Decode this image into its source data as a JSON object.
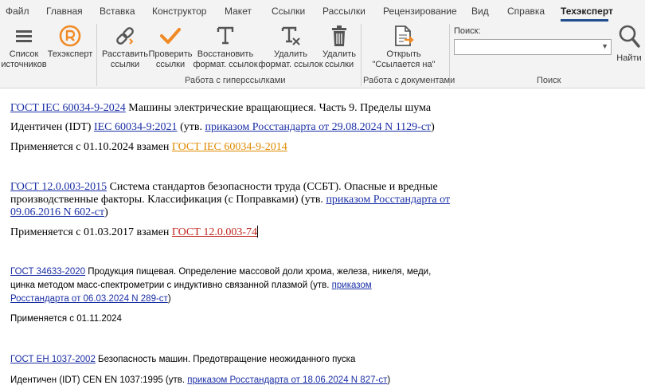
{
  "menu": {
    "tabs": [
      "Файл",
      "Главная",
      "Вставка",
      "Конструктор",
      "Макет",
      "Ссылки",
      "Рассылки",
      "Рецензирование",
      "Вид",
      "Справка",
      "Техэксперт"
    ],
    "active": "Техэксперт"
  },
  "ribbon": {
    "sources_list": "Список\nисточников",
    "techexpert": "Техэксперт",
    "place_links": "Расставить\nссылки",
    "check_links": "Проверить\nссылки",
    "restore_format": "Восстановить\nформат. ссылок",
    "delete_format": "Удалить\nформат. ссылок",
    "delete_links": "Удалить\nссылки",
    "open_referenced": "Открыть\n\"Ссылается на\"",
    "group_hyperlinks": "Работа с гиперссылками",
    "group_documents": "Работа с документами",
    "search_label": "Поиск:",
    "search_value": "",
    "find": "Найти",
    "group_search": "Поиск"
  },
  "document": {
    "b1": {
      "link": "ГОСТ IEC 60034-9-2024",
      "title": " Машины электрические вращающиеся. Часть 9. Пределы шума",
      "ident_pre": "Идентичен (IDT) ",
      "ident_link": "IEC 60034-9:2021",
      "ident_mid": " (утв. ",
      "ident_order": "приказом Росстандарта от 29.08.2024 N 1129-ст",
      "ident_end": ")",
      "applies_pre": "Применяется с 01.10.2024 взамен ",
      "applies_link": "ГОСТ IEC 60034-9-2014"
    },
    "b2": {
      "link": "ГОСТ 12.0.003-2015",
      "title_l1": " Система стандартов безопасности труда (ССБТ). Опасные и вредные",
      "title_l2_pre": "производственные факторы. Классификация (с Поправками) (утв. ",
      "order_l2": "приказом Росстандарта от",
      "order_l3": "09.06.2016 N 602-ст",
      "title_l3_end": ")",
      "applies_pre": "Применяется с 01.03.2017 взамен ",
      "applies_link": "ГОСТ 12.0.003-74"
    },
    "b3": {
      "link": "ГОСТ 34633-2020",
      "title_l1": " Продукция пищевая. Определение массовой доли хрома, железа, никеля, меди,",
      "title_l2_pre": "цинка методом масс-спектрометрии с индуктивно связанной плазмой (утв. ",
      "order_l2": "приказом",
      "order_l3": "Росстандарта от 06.03.2024 N 289-ст",
      "title_l3_end": ")",
      "applies": "Применяется с 01.11.2024"
    },
    "b4": {
      "link": "ГОСТ EH 1037-2002",
      "title": " Безопасность машин. Предотвращение неожиданного пуска",
      "ident_pre": "Идентичен (IDT) CEN EN 1037:1995 (утв. ",
      "ident_order": "приказом Росстандарта от 18.06.2024 N 827-ст",
      "ident_end": ")"
    }
  },
  "colors": {
    "link_blue": "#1b2fa5",
    "link_orange": "#e08a00",
    "link_red": "#c0261f",
    "active_tab_underline": "#1f4e8c",
    "icon_orange": "#f08a24"
  }
}
